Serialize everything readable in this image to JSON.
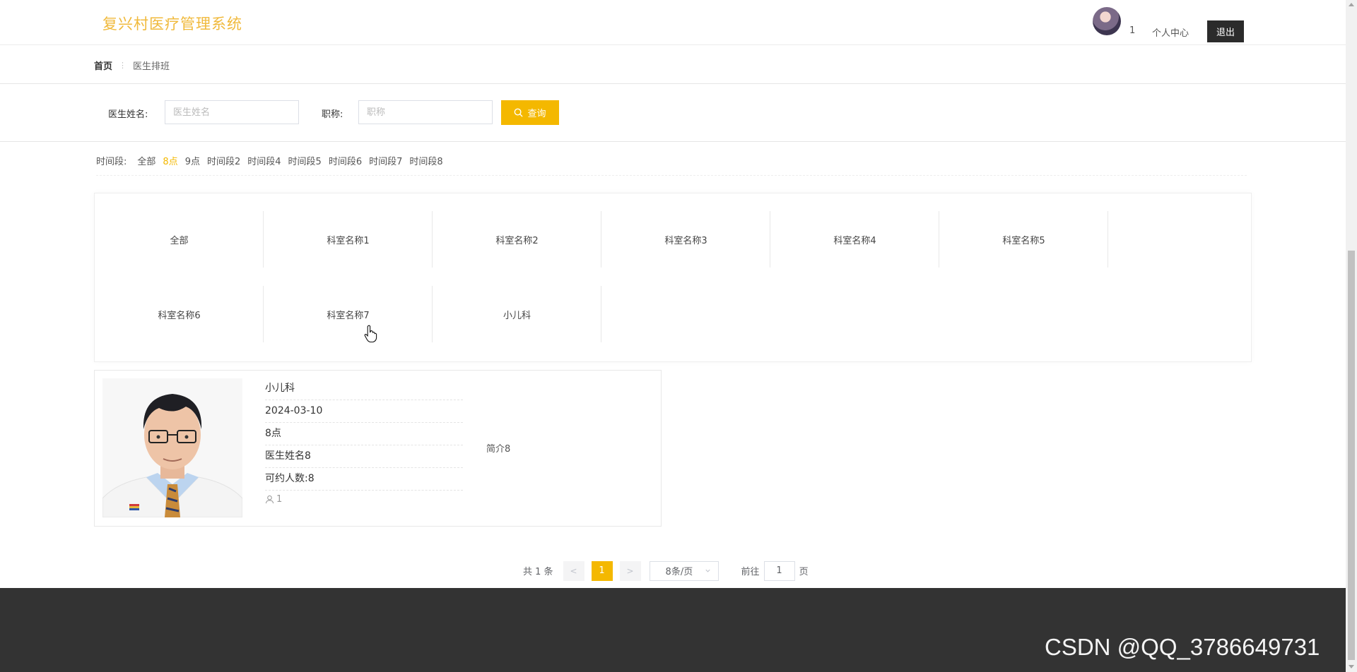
{
  "header": {
    "title": "复兴村医疗管理系统",
    "user": "1",
    "personal_center": "个人中心",
    "logout": "退出"
  },
  "breadcrumb": {
    "home": "首页",
    "current": "医生排班"
  },
  "search": {
    "name_label": "医生姓名:",
    "name_placeholder": "医生姓名",
    "title_label": "职称:",
    "title_placeholder": "职称",
    "query_button": "查询"
  },
  "time_filter": {
    "label": "时间段:",
    "options": [
      "全部",
      "8点",
      "9点",
      "时间段2",
      "时间段4",
      "时间段5",
      "时间段6",
      "时间段7",
      "时间段8"
    ],
    "active": "8点"
  },
  "departments": [
    "全部",
    "科室名称1",
    "科室名称2",
    "科室名称3",
    "科室名称4",
    "科室名称5",
    "科室名称6",
    "科室名称7",
    "小儿科"
  ],
  "doctor_card": {
    "department": "小儿科",
    "date": "2024-03-10",
    "time": "8点",
    "doctor_name": "医生姓名8",
    "capacity": "可约人数:8",
    "likes": "1",
    "intro": "简介8"
  },
  "pagination": {
    "total": "共 1 条",
    "prev": "<",
    "current_page": "1",
    "next": ">",
    "page_size": "8条/页",
    "goto_label": "前往",
    "goto_value": "1",
    "page_suffix": "页"
  },
  "watermark": "CSDN @QQ_3786649731",
  "colors": {
    "brand_title": "#f0b93b",
    "accent": "#f4b800",
    "footer": "#333333",
    "logout_bg": "#2b2b2b"
  }
}
